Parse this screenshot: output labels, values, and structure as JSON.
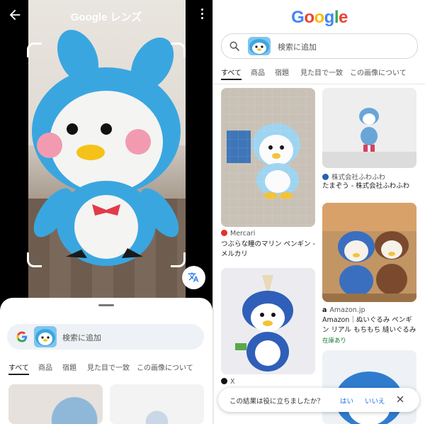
{
  "left_screen": {
    "app_title": "Google レンズ",
    "search_placeholder": "検索に追加",
    "tabs": [
      "すべて",
      "商品",
      "宿題",
      "見た目で一致",
      "この画像について"
    ],
    "active_tab": "すべて",
    "icons": [
      "back-arrow-icon",
      "more-vert-icon",
      "translate-icon",
      "google-g-icon"
    ]
  },
  "right_screen": {
    "logo": "Google",
    "logo_colors": [
      "#4285F4",
      "#EA4335",
      "#FBBC05",
      "#4285F4",
      "#34A853",
      "#EA4335"
    ],
    "search_placeholder": "検索に追加",
    "tabs": [
      "すべて",
      "商品",
      "宿題",
      "見た目で一致",
      "この画像について"
    ],
    "active_tab": "すべて",
    "results": [
      {
        "source": "Mercari",
        "title": "つぶらな瞳のマリン ペンギン - メルカリ"
      },
      {
        "source": "株式会社ふわふわ",
        "title": "たまぞう - 株式会社ふわふわ"
      },
      {
        "source": "Amazon.jp",
        "title": "Amazon｜ぬいぐるみ ペンギン リアル もちもち 縫いぐるみ 動...",
        "badge": "在庫あり"
      },
      {
        "source": "X",
        "title": ""
      }
    ],
    "feedback": {
      "question": "この結果は役に立ちましたか？",
      "yes": "はい",
      "no": "いいえ"
    },
    "icons": [
      "search-icon",
      "close-icon"
    ]
  }
}
